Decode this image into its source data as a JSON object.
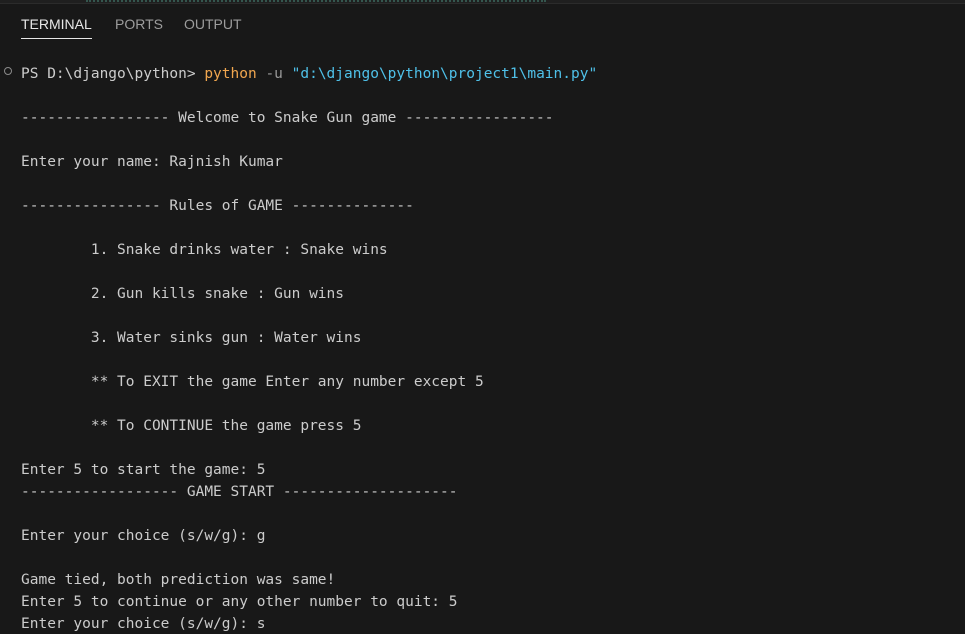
{
  "tabs": [
    {
      "label": "TERMINAL",
      "active": true
    },
    {
      "label": "PORTS",
      "active": false
    },
    {
      "label": "OUTPUT",
      "active": false
    }
  ],
  "terminal": {
    "prompt": "PS D:\\django\\python> ",
    "command": "python",
    "flag": " -u ",
    "path": "\"d:\\django\\python\\project1\\main.py\"",
    "lines": [
      "----------------- Welcome to Snake Gun game -----------------",
      "Enter your name: Rajnish Kumar",
      "---------------- Rules of GAME --------------",
      "        1. Snake drinks water : Snake wins",
      "        2. Gun kills snake : Gun wins",
      "        3. Water sinks gun : Water wins",
      "        ** To EXIT the game Enter any number except 5",
      "        ** To CONTINUE the game press 5",
      "Enter 5 to start the game: 5",
      "------------------ GAME START --------------------",
      "Enter your choice (s/w/g): g",
      "Game tied, both prediction was same!",
      "Enter 5 to continue or any other number to quit: 5",
      "Enter your choice (s/w/g): s"
    ]
  },
  "colors": {
    "background": "#181818",
    "text": "#cccccc",
    "python": "#f0a64f",
    "path": "#4fc1e9",
    "flag": "#9a9a9a"
  }
}
